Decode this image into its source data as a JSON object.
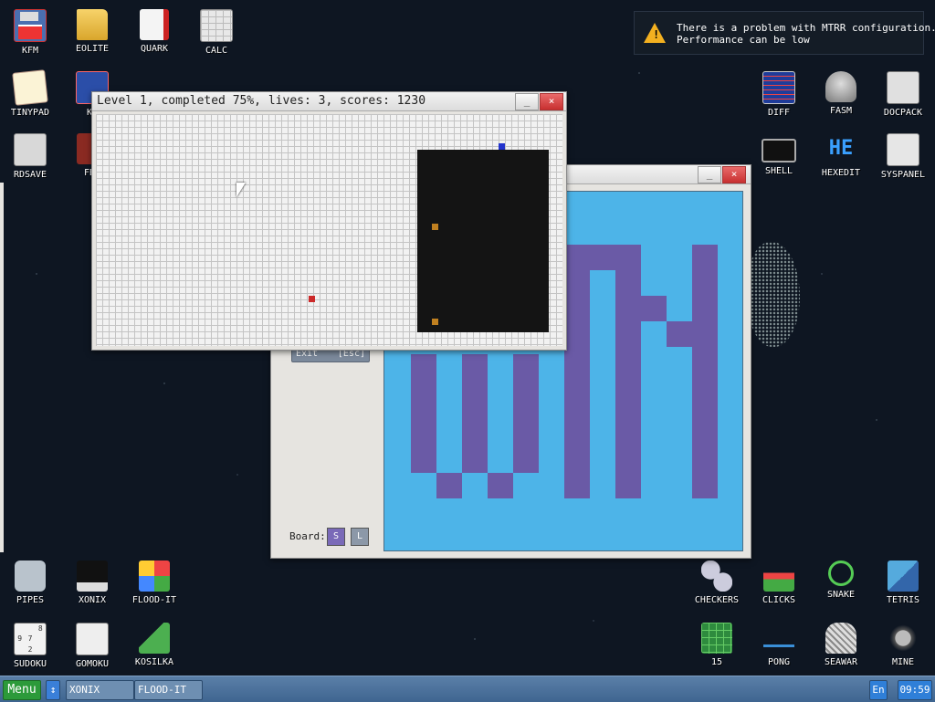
{
  "desktop_left": [
    {
      "label": "KFM",
      "icon": "floppy-icon"
    },
    {
      "label": "EOLITE",
      "icon": "folder-icon"
    },
    {
      "label": "QUARK",
      "icon": "notebook-icon"
    },
    {
      "label": "CALC",
      "icon": "calculator-icon"
    },
    {
      "label": "TINYPAD",
      "icon": "notepad-icon"
    },
    {
      "label": "KF",
      "icon": "kfm-window-icon"
    },
    {
      "label": "RDSAVE",
      "icon": "rdsave-icon"
    },
    {
      "label": "FB2",
      "icon": "book-icon"
    }
  ],
  "desktop_right": [
    {
      "label": "DIFF",
      "icon": "diff-icon"
    },
    {
      "label": "FASM",
      "icon": "fasm-icon"
    },
    {
      "label": "DOCPACK",
      "icon": "docpack-icon"
    },
    {
      "label": "SHELL",
      "icon": "terminal-icon"
    },
    {
      "label": "HEXEDIT",
      "icon": "hexedit-icon",
      "text": "HE"
    },
    {
      "label": "SYSPANEL",
      "icon": "sliders-icon"
    }
  ],
  "desktop_bottom": [
    {
      "label": "PIPES",
      "icon": "pipes-icon"
    },
    {
      "label": "XONIX",
      "icon": "xonix-icon"
    },
    {
      "label": "FLOOD-IT",
      "icon": "flood-it-icon"
    },
    {
      "label": "SUDOKU",
      "icon": "sudoku-icon",
      "grid": [
        "",
        "",
        "8",
        "9",
        "7",
        "",
        "",
        "2",
        ""
      ]
    },
    {
      "label": "GOMOKU",
      "icon": "gomoku-icon"
    },
    {
      "label": "KOSILKA",
      "icon": "lawnmower-icon"
    },
    {
      "label": "CHECKERS",
      "icon": "checkers-icon"
    },
    {
      "label": "CLICKS",
      "icon": "clicks-icon"
    },
    {
      "label": "SNAKE",
      "icon": "snake-icon"
    },
    {
      "label": "TETRIS",
      "icon": "tetris-icon"
    },
    {
      "label": "15",
      "icon": "fifteen-icon"
    },
    {
      "label": "PONG",
      "icon": "pong-icon"
    },
    {
      "label": "SEAWAR",
      "icon": "seawar-icon"
    },
    {
      "label": "MINE",
      "icon": "mine-icon"
    }
  ],
  "notification": {
    "line1": "There is a problem with MTRR configuration.",
    "line2": "Performance can be low",
    "icon": "warning-icon"
  },
  "xonix_window": {
    "title": "Level 1, completed 75%, lives: 3, scores: 1230",
    "minimize": "_",
    "close": "×",
    "level": 1,
    "completed_percent": 75,
    "lives": 3,
    "scores": 1230
  },
  "flood_window": {
    "minimize": "_",
    "close": "×",
    "exit_label": "Exit",
    "esc_label": "[Esc]",
    "board_label": "Board:",
    "board_s": "S",
    "board_l": "L",
    "colors": {
      "light": "#4db4e8",
      "dark": "#6a5aa6"
    }
  },
  "taskbar": {
    "menu": "Menu",
    "arrow": "↕",
    "tasks": [
      "XONIX",
      "FLOOD-IT"
    ],
    "lang": "En",
    "clock": "09:59"
  }
}
